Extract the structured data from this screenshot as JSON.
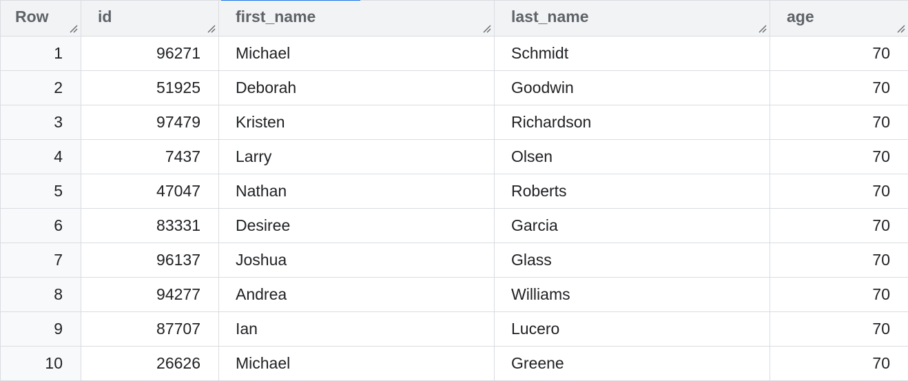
{
  "columns": [
    {
      "key": "row",
      "label": "Row",
      "icon": "column-resize-icon"
    },
    {
      "key": "id",
      "label": "id",
      "icon": "column-resize-icon"
    },
    {
      "key": "first_name",
      "label": "first_name",
      "icon": "column-resize-icon"
    },
    {
      "key": "last_name",
      "label": "last_name",
      "icon": "column-resize-icon"
    },
    {
      "key": "age",
      "label": "age",
      "icon": "column-resize-icon"
    }
  ],
  "rows": [
    {
      "row": "1",
      "id": "96271",
      "first_name": "Michael",
      "last_name": "Schmidt",
      "age": "70"
    },
    {
      "row": "2",
      "id": "51925",
      "first_name": "Deborah",
      "last_name": "Goodwin",
      "age": "70"
    },
    {
      "row": "3",
      "id": "97479",
      "first_name": "Kristen",
      "last_name": "Richardson",
      "age": "70"
    },
    {
      "row": "4",
      "id": "7437",
      "first_name": "Larry",
      "last_name": "Olsen",
      "age": "70"
    },
    {
      "row": "5",
      "id": "47047",
      "first_name": "Nathan",
      "last_name": "Roberts",
      "age": "70"
    },
    {
      "row": "6",
      "id": "83331",
      "first_name": "Desiree",
      "last_name": "Garcia",
      "age": "70"
    },
    {
      "row": "7",
      "id": "96137",
      "first_name": "Joshua",
      "last_name": "Glass",
      "age": "70"
    },
    {
      "row": "8",
      "id": "94277",
      "first_name": "Andrea",
      "last_name": "Williams",
      "age": "70"
    },
    {
      "row": "9",
      "id": "87707",
      "first_name": "Ian",
      "last_name": "Lucero",
      "age": "70"
    },
    {
      "row": "10",
      "id": "26626",
      "first_name": "Michael",
      "last_name": "Greene",
      "age": "70"
    }
  ],
  "colors": {
    "header_bg": "#f1f3f4",
    "row_num_bg": "#f8f9fa",
    "grid_line": "#dadce0",
    "accent": "#1a73e8"
  }
}
